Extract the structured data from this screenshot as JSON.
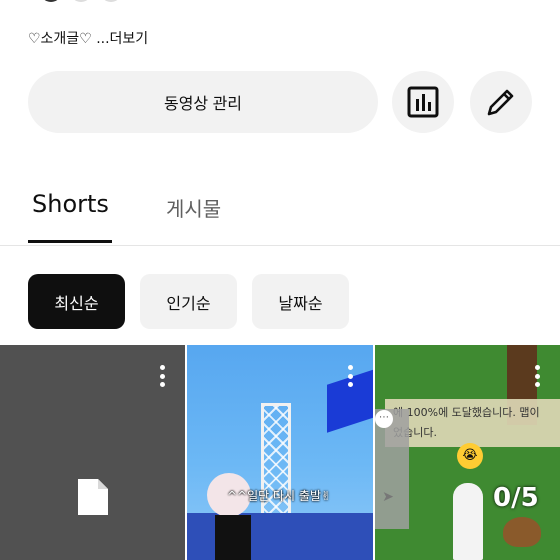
{
  "profile": {
    "bio_text": "♡소개글♡ ...더보기"
  },
  "actions": {
    "manage_videos_label": "동영상 관리",
    "stats_icon": "bar-chart-icon",
    "edit_icon": "pencil-icon"
  },
  "tabs": [
    {
      "label": "Shorts",
      "selected": true
    },
    {
      "label": "게시물",
      "selected": false
    }
  ],
  "sort_chips": [
    {
      "label": "최신순",
      "selected": true
    },
    {
      "label": "인기순",
      "selected": false
    },
    {
      "label": "날짜순",
      "selected": false
    }
  ],
  "videos": [
    {
      "thumbnail_icon": "file-icon"
    },
    {
      "caption": "^^일단 다시 출발✌"
    },
    {
      "banner_line1": "에 100%에 도달했습니다. 맵이",
      "banner_line2": "었습니다.",
      "score": "0/5"
    }
  ],
  "colors": {
    "accent": "#0f0f0f",
    "chip_bg": "#f2f2f2",
    "selected_chip_text": "#ffffff"
  }
}
